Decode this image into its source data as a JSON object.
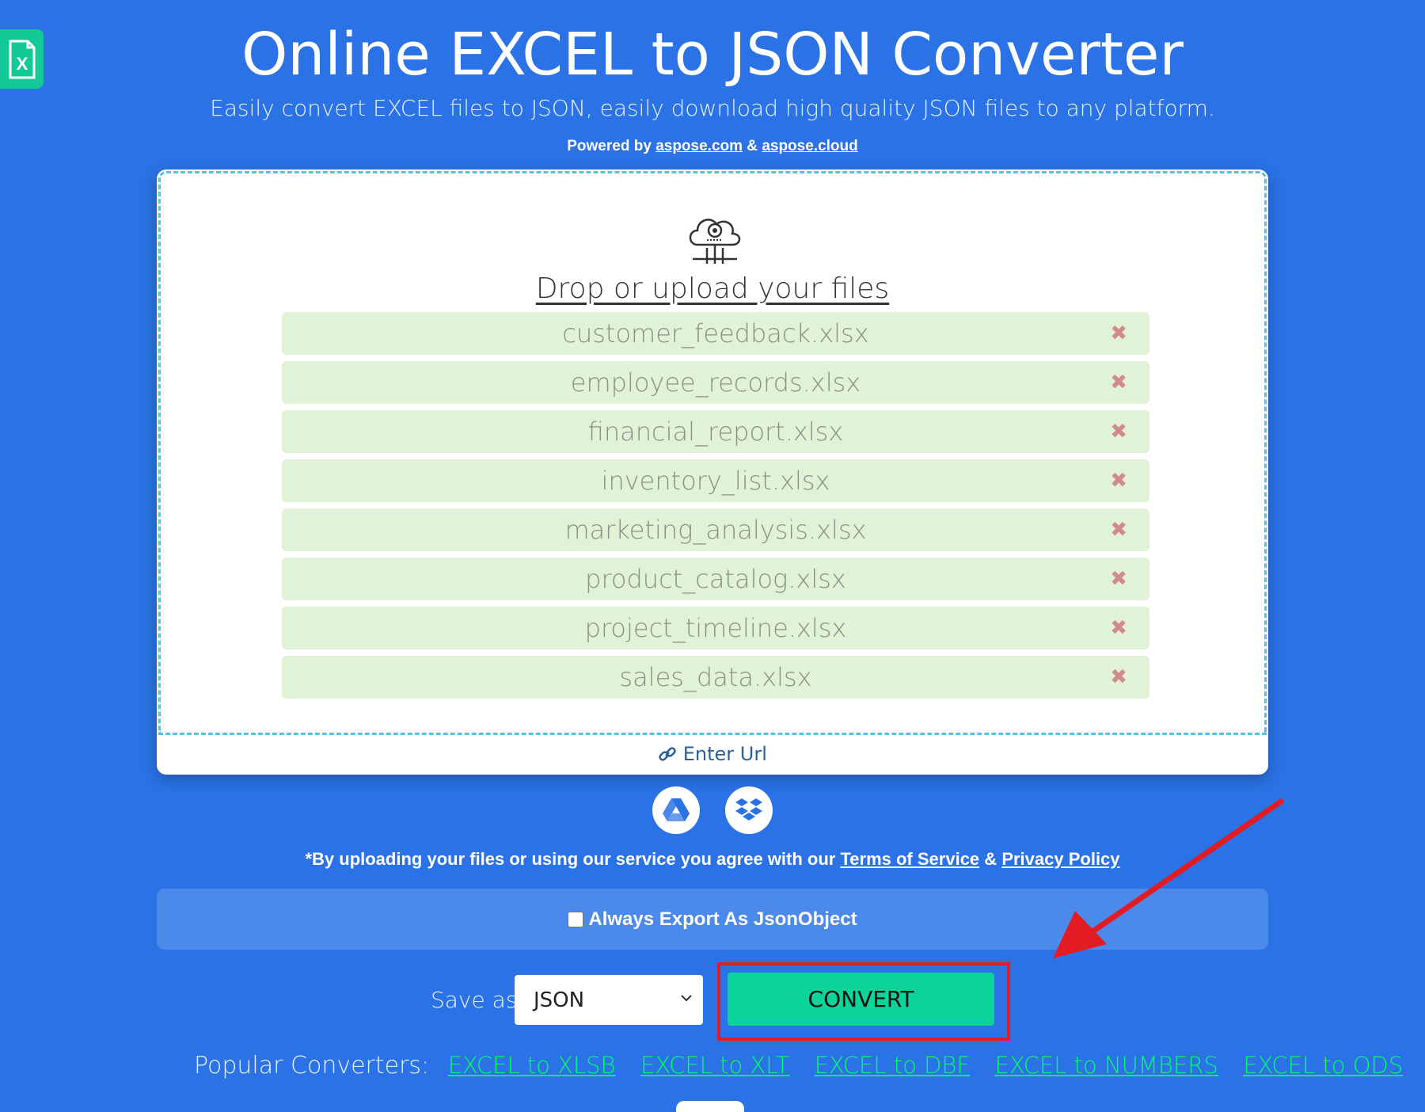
{
  "header": {
    "title": "Online EXCEL to JSON Converter",
    "subtitle": "Easily convert EXCEL files to JSON, easily download high quality JSON files to any platform.",
    "powered_prefix": "Powered by",
    "powered_link1": "aspose.com",
    "powered_amp": "&",
    "powered_link2": "aspose.cloud"
  },
  "upload": {
    "drop_label": "Drop or upload your files",
    "remove_glyph": "✖",
    "files": [
      "customer_feedback.xlsx",
      "employee_records.xlsx",
      "financial_report.xlsx",
      "inventory_list.xlsx",
      "marketing_analysis.xlsx",
      "product_catalog.xlsx",
      "project_timeline.xlsx",
      "sales_data.xlsx"
    ],
    "enter_url": "Enter Url"
  },
  "agreement": {
    "prefix": "*By uploading your files or using our service you agree with our",
    "terms": "Terms of Service",
    "amp": "&",
    "privacy": "Privacy Policy"
  },
  "options": {
    "always_export_label": "Always Export As JsonObject"
  },
  "save": {
    "label": "Save as",
    "format": "JSON",
    "convert_label": "CONVERT"
  },
  "popular": {
    "label": "Popular Converters:",
    "links": [
      "EXCEL to XLSB",
      "EXCEL to XLT",
      "EXCEL to DBF",
      "EXCEL to NUMBERS",
      "EXCEL to ODS"
    ]
  },
  "colors": {
    "background": "#2a72e5",
    "convert": "#0bd39a",
    "file_row": "#e1f3d6",
    "highlight": "#e31b23",
    "link_green": "#00ff66"
  }
}
